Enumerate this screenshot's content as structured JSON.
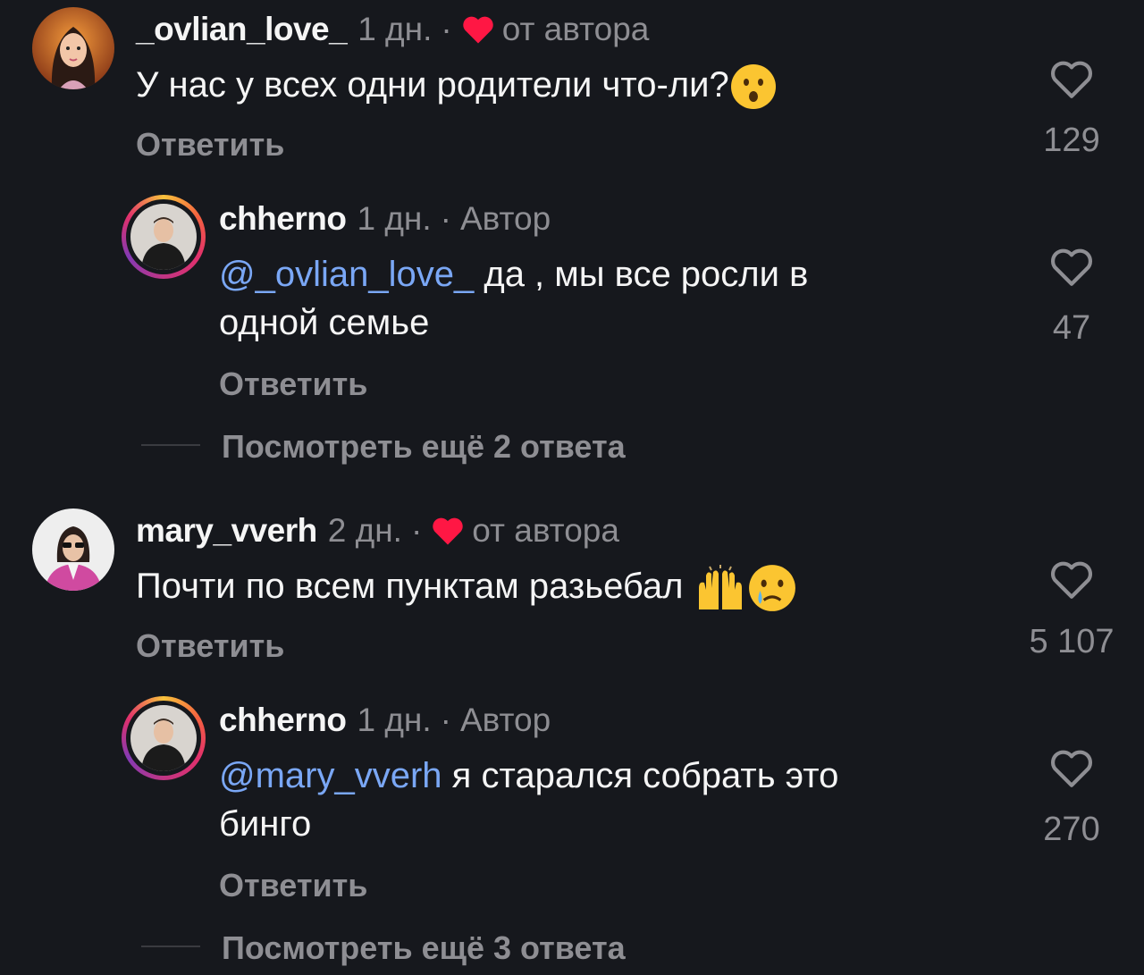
{
  "comments": [
    {
      "username": "_ovlian_love_",
      "time": "1 дн.",
      "dot": "·",
      "liked_by_author": "от автора",
      "text": "У нас у всех одни родители что-ли?",
      "reply_label": "Ответить",
      "likes": "129",
      "avatar_icon": "woman-doll-avatar"
    },
    {
      "username": "chherno",
      "time": "1 дн.",
      "dot": "·",
      "author_tag": "Автор",
      "mention": "@_ovlian_love_",
      "text_line1": " да , мы все росли в",
      "text_line2": "одной семье",
      "reply_label": "Ответить",
      "likes": "47",
      "avatar_icon": "man-avatar"
    },
    {
      "more_replies": "Посмотреть ещё 2 ответа"
    },
    {
      "username": "mary_vverh",
      "time": "2 дн.",
      "dot": "·",
      "liked_by_author": "от автора",
      "text": "Почти по всем пунктам разьебал",
      "reply_label": "Ответить",
      "likes": "5 107",
      "avatar_icon": "woman-pink-jacket-avatar"
    },
    {
      "username": "chherno",
      "time": "1 дн.",
      "dot": "·",
      "author_tag": "Автор",
      "mention": "@mary_vverh",
      "text_line1": " я старался собрать это",
      "text_line2": "бинго",
      "reply_label": "Ответить",
      "likes": "270",
      "avatar_icon": "man-avatar"
    },
    {
      "more_replies": "Посмотреть ещё 3 ответа"
    }
  ],
  "colors": {
    "background": "#16181d",
    "text": "#f5f5f5",
    "secondary": "#8e8e93",
    "mention": "#7aa7f5",
    "heart_red": "#ff1744"
  }
}
